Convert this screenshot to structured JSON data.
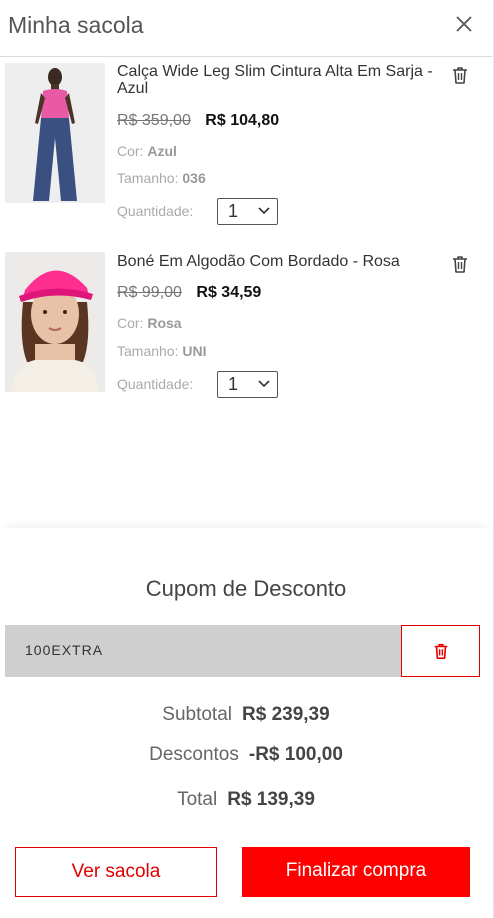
{
  "header": {
    "title": "Minha sacola"
  },
  "items": [
    {
      "name": "Calça Wide Leg Slim Cintura Alta Em Sarja - Azul",
      "price_old": "R$ 359,00",
      "price_new": "R$ 104,80",
      "color_label": "Cor:",
      "color_value": "Azul",
      "size_label": "Tamanho:",
      "size_value": "036",
      "qty_label": "Quantidade:",
      "qty_value": "1"
    },
    {
      "name": "Boné Em Algodão Com Bordado - Rosa",
      "price_old": "R$ 99,00",
      "price_new": "R$ 34,59",
      "color_label": "Cor:",
      "color_value": "Rosa",
      "size_label": "Tamanho:",
      "size_value": "UNI",
      "qty_label": "Quantidade:",
      "qty_value": "1"
    }
  ],
  "coupon": {
    "title": "Cupom de Desconto",
    "code": "100EXTRA"
  },
  "summary": {
    "subtotal_label": "Subtotal",
    "subtotal_value": "R$ 239,39",
    "discount_label": "Descontos",
    "discount_value": "-R$ 100,00",
    "total_label": "Total",
    "total_value": "R$ 139,39"
  },
  "buttons": {
    "view_bag": "Ver sacola",
    "checkout": "Finalizar compra"
  },
  "colors": {
    "accent": "#ff0000",
    "accent_border": "#e10000",
    "coupon_bg": "#cfcfcf"
  },
  "icons": {
    "close": "close-icon",
    "trash": "trash-icon",
    "chevron": "chevron-down-icon"
  }
}
